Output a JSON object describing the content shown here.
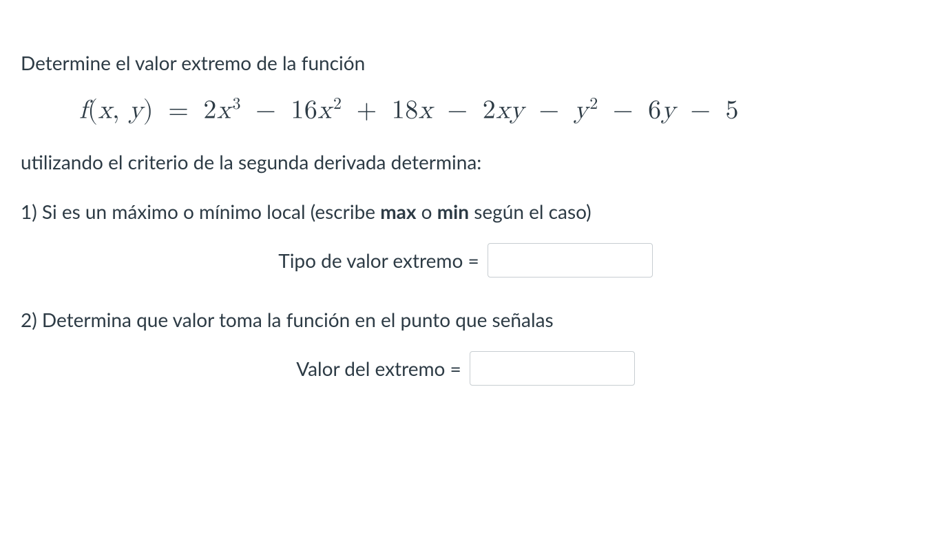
{
  "intro": "Determine el valor extremo de la función",
  "equation": {
    "lhs_f": "f",
    "lhs_open": "(",
    "lhs_x": "x",
    "lhs_comma": ",",
    "lhs_y": "y",
    "lhs_close": ")",
    "eq": "=",
    "t1_coef": "2",
    "t1_var": "x",
    "t1_exp": "3",
    "minus1": "−",
    "t2_coef": "16",
    "t2_var": "x",
    "t2_exp": "2",
    "plus1": "+",
    "t3_coef": "18",
    "t3_var": "x",
    "minus2": "−",
    "t4_coef": "2",
    "t4_var1": "x",
    "t4_var2": "y",
    "minus3": "−",
    "t5_var": "y",
    "t5_exp": "2",
    "minus4": "−",
    "t6_coef": "6",
    "t6_var": "y",
    "minus5": "−",
    "t7": "5"
  },
  "subtext": "utilizando el criterio de la segunda derivada determina:",
  "q1": {
    "prefix": "1) Si es un máximo o mínimo local (escribe ",
    "bold1": "max",
    "mid": " o ",
    "bold2": "min",
    "suffix": " según el caso)"
  },
  "input1": {
    "label": "Tipo de valor extremo =",
    "value": ""
  },
  "q2": "2) Determina que valor toma la función en el punto que señalas",
  "input2": {
    "label": "Valor del extremo =",
    "value": ""
  }
}
